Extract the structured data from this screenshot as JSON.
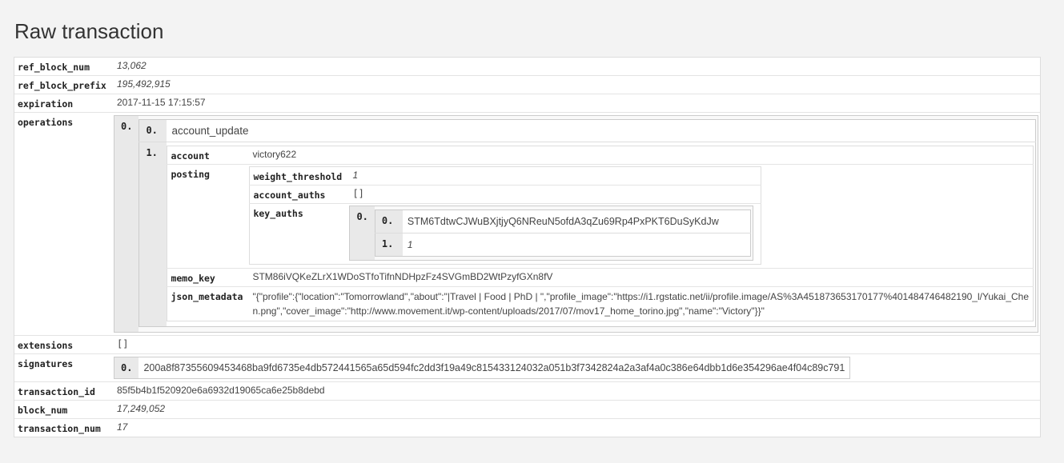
{
  "page": {
    "title": "Raw transaction"
  },
  "tx": {
    "ref_block_num": {
      "key": "ref_block_num",
      "value": "13,062"
    },
    "ref_block_prefix": {
      "key": "ref_block_prefix",
      "value": "195,492,915"
    },
    "expiration": {
      "key": "expiration",
      "value": "2017-11-15 17:15:57"
    },
    "operations": {
      "key": "operations",
      "outer_index": "0.",
      "name_index": "0.",
      "name": "account_update",
      "body_index": "1.",
      "account": {
        "key": "account",
        "value": "victory622"
      },
      "posting": {
        "key": "posting",
        "weight_threshold": {
          "key": "weight_threshold",
          "value": "1"
        },
        "account_auths": {
          "key": "account_auths",
          "value": "[]"
        },
        "key_auths": {
          "key": "key_auths",
          "outer_index": "0.",
          "items": [
            {
              "index": "0.",
              "value": "STM6TdtwCJWuBXjtjyQ6NReuN5ofdA3qZu69Rp4PxPKT6DuSyKdJw"
            },
            {
              "index": "1.",
              "value": "1"
            }
          ]
        }
      },
      "memo_key": {
        "key": "memo_key",
        "value": "STM86iVQKeZLrX1WDoSTfoTifnNDHpzFz4SVGmBD2WtPzyfGXn8fV"
      },
      "json_metadata": {
        "key": "json_metadata",
        "value": "\"{\"profile\":{\"location\":\"Tomorrowland\",\"about\":\"|Travel | Food | PhD | \",\"profile_image\":\"https://i1.rgstatic.net/ii/profile.image/AS%3A451873653170177%401484746482190_l/Yukai_Chen.png\",\"cover_image\":\"http://www.movement.it/wp-content/uploads/2017/07/mov17_home_torino.jpg\",\"name\":\"Victory\"}}\""
      }
    },
    "extensions": {
      "key": "extensions",
      "value": "[]"
    },
    "signatures": {
      "key": "signatures",
      "items": [
        {
          "index": "0.",
          "value": "200a8f87355609453468ba9fd6735e4db572441565a65d594fc2dd3f19a49c815433124032a051b3f7342824a2a3af4a0c386e64dbb1d6e354296ae4f04c89c791"
        }
      ]
    },
    "transaction_id": {
      "key": "transaction_id",
      "value": "85f5b4b1f520920e6a6932d19065ca6e25b8debd"
    },
    "block_num": {
      "key": "block_num",
      "value": "17,249,052"
    },
    "transaction_num": {
      "key": "transaction_num",
      "value": "17"
    }
  }
}
